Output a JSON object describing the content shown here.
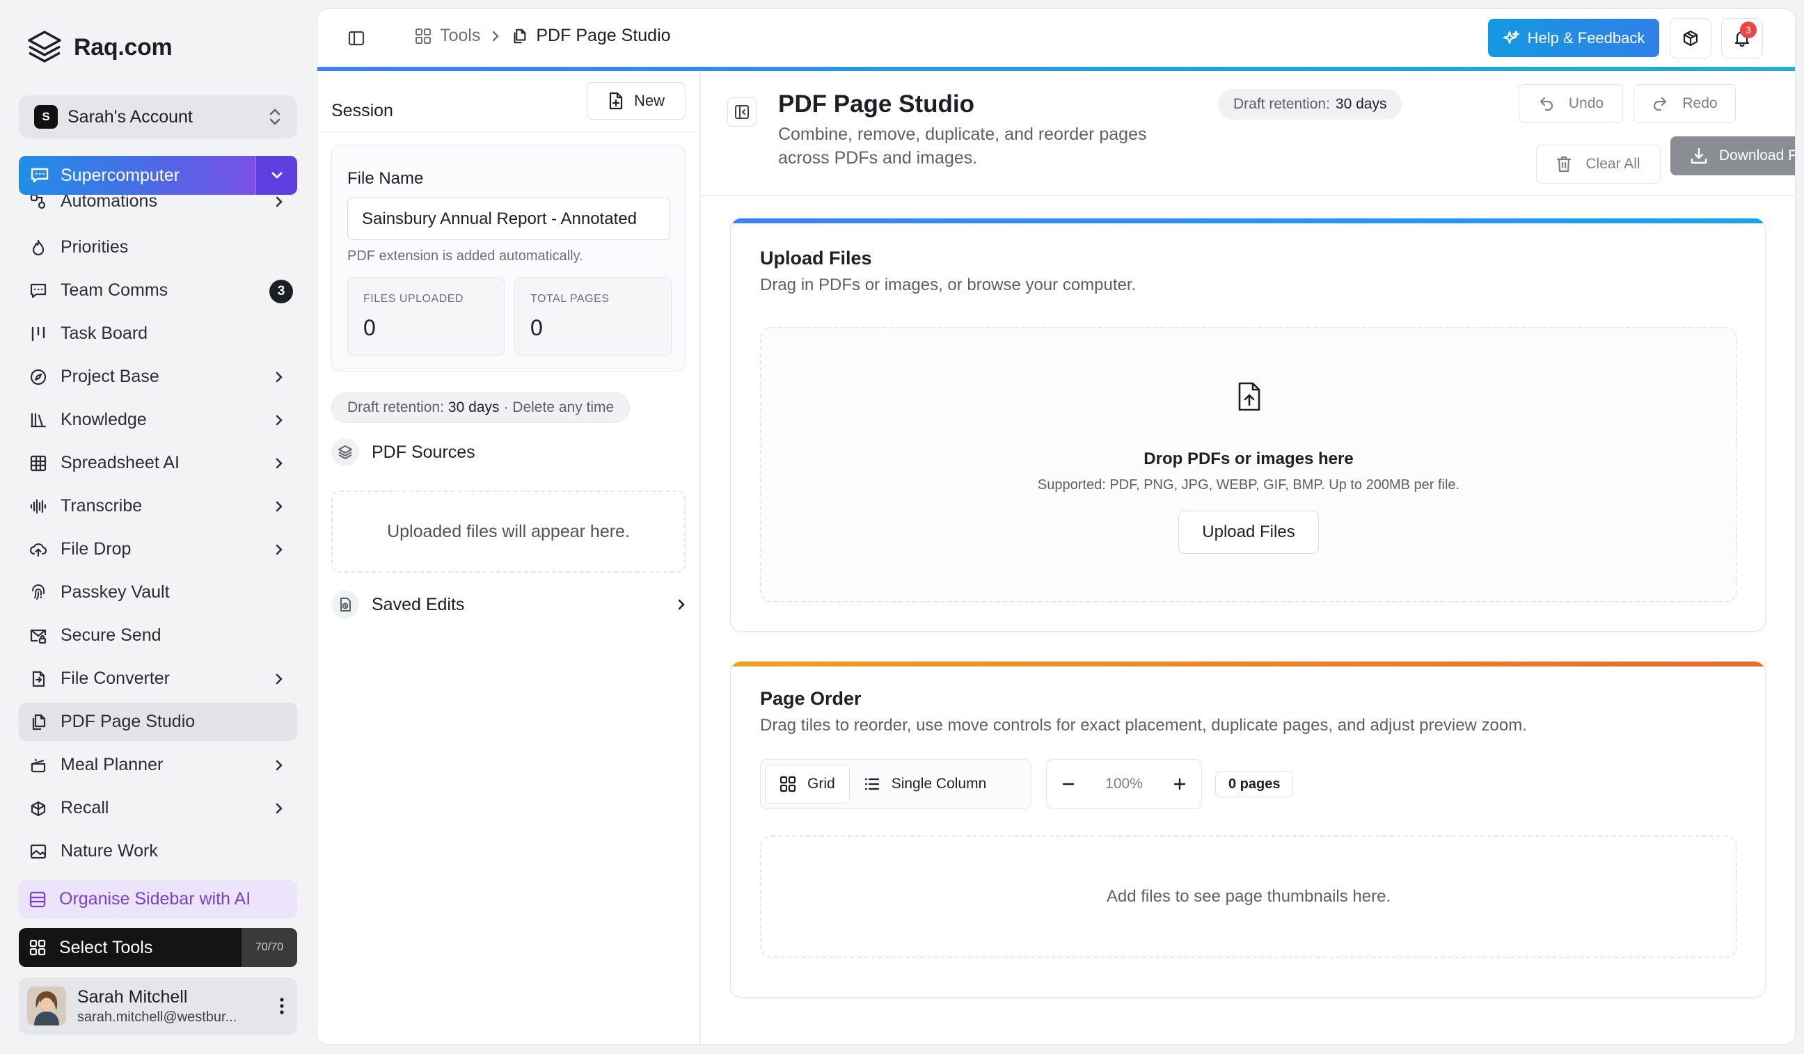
{
  "brand": {
    "name": "Raq.com"
  },
  "account": {
    "initial": "S",
    "name": "Sarah's Account"
  },
  "supercomputer": {
    "label": "Supercomputer"
  },
  "sidebar": {
    "items": [
      {
        "label": "Automations",
        "icon": "automations-icon",
        "chevron": true
      },
      {
        "label": "Priorities",
        "icon": "flame-icon"
      },
      {
        "label": "Team Comms",
        "icon": "chat-icon",
        "badge": "3"
      },
      {
        "label": "Task Board",
        "icon": "kanban-icon"
      },
      {
        "label": "Project Base",
        "icon": "compass-icon",
        "chevron": true
      },
      {
        "label": "Knowledge",
        "icon": "library-icon",
        "chevron": true
      },
      {
        "label": "Spreadsheet AI",
        "icon": "table-icon",
        "chevron": true
      },
      {
        "label": "Transcribe",
        "icon": "audio-wave-icon",
        "chevron": true
      },
      {
        "label": "File Drop",
        "icon": "cloud-upload-icon",
        "chevron": true
      },
      {
        "label": "Passkey Vault",
        "icon": "fingerprint-icon"
      },
      {
        "label": "Secure Send",
        "icon": "secure-mail-icon"
      },
      {
        "label": "File Converter",
        "icon": "file-convert-icon",
        "chevron": true
      },
      {
        "label": "PDF Page Studio",
        "icon": "pdf-pages-icon",
        "active": true
      },
      {
        "label": "Meal Planner",
        "icon": "cooking-pot-icon",
        "chevron": true
      },
      {
        "label": "Recall",
        "icon": "brain-icon",
        "chevron": true
      },
      {
        "label": "Nature Work",
        "icon": "nature-image-icon"
      }
    ],
    "organise": "Organise Sidebar with AI",
    "select_tools": "Select Tools",
    "tools_count": "70/70"
  },
  "user": {
    "name": "Sarah Mitchell",
    "email": "sarah.mitchell@westbur..."
  },
  "topbar": {
    "crumb_tools": "Tools",
    "crumb_current": "PDF Page Studio",
    "help": "Help & Feedback",
    "notifications": "3"
  },
  "session": {
    "title": "Session",
    "new_label": "New",
    "file_name_label": "File Name",
    "file_name_value": "Sainsbury Annual Report - Annotated",
    "file_hint": "PDF extension is added automatically.",
    "files_uploaded_label": "FILES UPLOADED",
    "files_uploaded_value": "0",
    "total_pages_label": "TOTAL PAGES",
    "total_pages_value": "0",
    "retention_prefix": "Draft retention:",
    "retention_days": "30 days",
    "retention_suffix": "· Delete any time",
    "sources_title": "PDF Sources",
    "sources_empty": "Uploaded files will appear here.",
    "saved_edits": "Saved Edits"
  },
  "studio": {
    "title": "PDF Page Studio",
    "subtitle": "Combine, remove, duplicate, and reorder pages across PDFs and images.",
    "draft_label": "Draft retention:",
    "draft_value": "30 days",
    "undo": "Undo",
    "redo": "Redo",
    "clear_all": "Clear All",
    "download": "Download PDF"
  },
  "upload": {
    "title": "Upload Files",
    "subtitle": "Drag in PDFs or images, or browse your computer.",
    "drop_title": "Drop PDFs or images here",
    "drop_sub": "Supported: PDF, PNG, JPG, WEBP, GIF, BMP. Up to 200MB per file.",
    "button": "Upload Files"
  },
  "page_order": {
    "title": "Page Order",
    "subtitle": "Drag tiles to reorder, use move controls for exact placement, duplicate pages, and adjust preview zoom.",
    "grid": "Grid",
    "single_column": "Single Column",
    "zoom": "100%",
    "pages": "0 pages",
    "empty": "Add files to see page thumbnails here."
  },
  "colors": {
    "accent_blue": "#1f8fe6",
    "accent_purple": "#7a3fd0",
    "upload_bar": "#3b82f6",
    "page_order_bar": "#f08a24",
    "badge_red": "#ef4444"
  }
}
